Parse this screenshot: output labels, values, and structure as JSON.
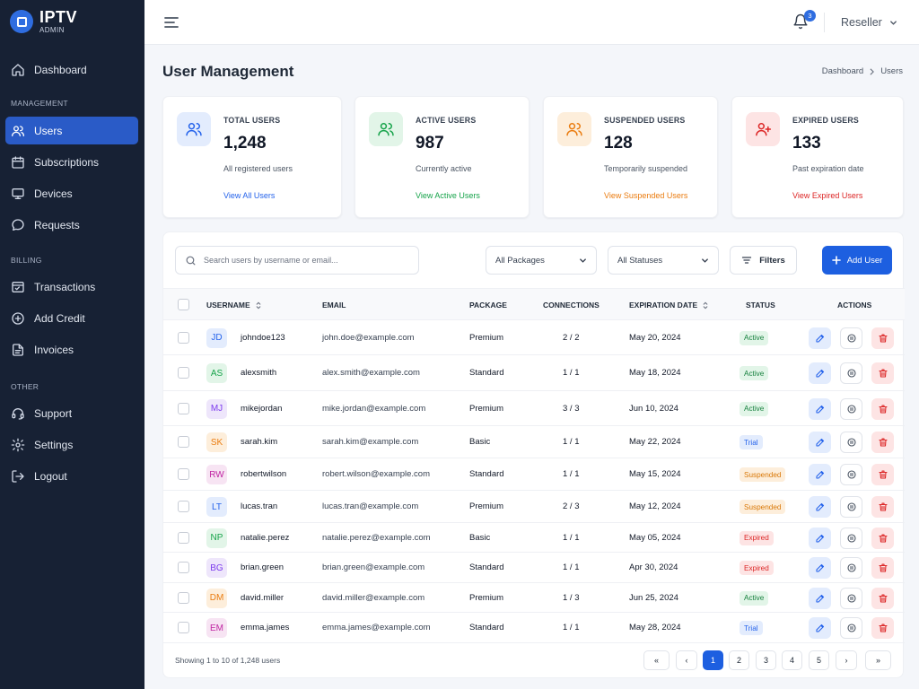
{
  "brand": {
    "title": "IPTV",
    "subtitle": "ADMIN"
  },
  "sidebar": {
    "sections": {
      "management": "MANAGEMENT",
      "billing": "BILLING",
      "other": "OTHER"
    },
    "items": [
      {
        "label": "Dashboard",
        "icon": "home-icon"
      },
      {
        "label": "Users",
        "icon": "users-icon",
        "active": true
      },
      {
        "label": "Subscriptions",
        "icon": "calendar-icon"
      },
      {
        "label": "Devices",
        "icon": "monitor-icon"
      },
      {
        "label": "Requests",
        "icon": "message-icon"
      },
      {
        "label": "Transactions",
        "icon": "receipt-icon"
      },
      {
        "label": "Add Credit",
        "icon": "plus-circle-icon"
      },
      {
        "label": "Invoices",
        "icon": "document-icon"
      },
      {
        "label": "Support",
        "icon": "headset-icon"
      },
      {
        "label": "Settings",
        "icon": "gear-icon"
      },
      {
        "label": "Logout",
        "icon": "logout-icon"
      }
    ]
  },
  "topbar": {
    "notifications": "3",
    "user": "Reseller"
  },
  "page": {
    "title": "User Management",
    "breadcrumb": [
      "Dashboard",
      "Users"
    ]
  },
  "stats": [
    {
      "label": "TOTAL USERS",
      "value": "1,248",
      "sub": "All registered users",
      "link": "View All Users",
      "color": "#2563eb",
      "bg": "#e3ecfd",
      "icon": "users-icon"
    },
    {
      "label": "ACTIVE USERS",
      "value": "987",
      "sub": "Currently active",
      "link": "View Active Users",
      "color": "#16a34a",
      "bg": "#e2f5e8",
      "icon": "users-icon"
    },
    {
      "label": "SUSPENDED USERS",
      "value": "128",
      "sub": "Temporarily suspended",
      "link": "View Suspended Users",
      "color": "#ea7c10",
      "bg": "#fdeedb",
      "icon": "users-icon"
    },
    {
      "label": "EXPIRED USERS",
      "value": "133",
      "sub": "Past expiration date",
      "link": "View Expired Users",
      "color": "#dc2626",
      "bg": "#fde4e4",
      "icon": "user-plus-icon"
    }
  ],
  "toolbar": {
    "search_placeholder": "Search users by username or email...",
    "package": "All Packages",
    "status": "All Statuses",
    "filters": "Filters",
    "add": "Add User"
  },
  "table": {
    "headers": {
      "username": "USERNAME",
      "email": "EMAIL",
      "package": "PACKAGE",
      "connections": "CONNECTIONS",
      "expiration": "EXPIRATION DATE",
      "status": "STATUS",
      "actions": "ACTIONS"
    },
    "rows": [
      {
        "initials": "JD",
        "username": "johndoe123",
        "email": "john.doe@example.com",
        "package": "Premium",
        "connections": "2 / 2",
        "expiration": "May 20, 2024",
        "status": "Active",
        "avatar_bg": "#e3ecfd",
        "avatar_fg": "#2563eb"
      },
      {
        "initials": "AS",
        "username": "alexsmith",
        "email": "alex.smith@example.com",
        "package": "Standard",
        "connections": "1 / 1",
        "expiration": "May 18, 2024",
        "status": "Active",
        "avatar_bg": "#e2f5e8",
        "avatar_fg": "#16a34a"
      },
      {
        "initials": "MJ",
        "username": "mikejordan",
        "email": "mike.jordan@example.com",
        "package": "Premium",
        "connections": "3 / 3",
        "expiration": "Jun 10, 2024",
        "status": "Active",
        "avatar_bg": "#eee6fb",
        "avatar_fg": "#7c3aed"
      },
      {
        "initials": "SK",
        "username": "sarah.kim",
        "email": "sarah.kim@example.com",
        "package": "Basic",
        "connections": "1 / 1",
        "expiration": "May 22, 2024",
        "status": "Trial",
        "avatar_bg": "#fdeedb",
        "avatar_fg": "#ea7c10"
      },
      {
        "initials": "RW",
        "username": "robertwilson",
        "email": "robert.wilson@example.com",
        "package": "Standard",
        "connections": "1 / 1",
        "expiration": "May 15, 2024",
        "status": "Suspended",
        "avatar_bg": "#f7e4f3",
        "avatar_fg": "#c026a3"
      },
      {
        "initials": "LT",
        "username": "lucas.tran",
        "email": "lucas.tran@example.com",
        "package": "Premium",
        "connections": "2 / 3",
        "expiration": "May 12, 2024",
        "status": "Suspended",
        "avatar_bg": "#e3ecfd",
        "avatar_fg": "#2563eb"
      },
      {
        "initials": "NP",
        "username": "natalie.perez",
        "email": "natalie.perez@example.com",
        "package": "Basic",
        "connections": "1 / 1",
        "expiration": "May 05, 2024",
        "status": "Expired",
        "avatar_bg": "#e2f5e8",
        "avatar_fg": "#16a34a"
      },
      {
        "initials": "BG",
        "username": "brian.green",
        "email": "brian.green@example.com",
        "package": "Standard",
        "connections": "1 / 1",
        "expiration": "Apr 30, 2024",
        "status": "Expired",
        "avatar_bg": "#eee6fb",
        "avatar_fg": "#7c3aed"
      },
      {
        "initials": "DM",
        "username": "david.miller",
        "email": "david.miller@example.com",
        "package": "Premium",
        "connections": "1 / 3",
        "expiration": "Jun 25, 2024",
        "status": "Active",
        "avatar_bg": "#fdeedb",
        "avatar_fg": "#ea7c10"
      },
      {
        "initials": "EM",
        "username": "emma.james",
        "email": "emma.james@example.com",
        "package": "Standard",
        "connections": "1 / 1",
        "expiration": "May 28, 2024",
        "status": "Trial",
        "avatar_bg": "#f7e4f3",
        "avatar_fg": "#c026a3"
      }
    ]
  },
  "status_colors": {
    "Active": {
      "bg": "#e2f5e8",
      "fg": "#15803d"
    },
    "Trial": {
      "bg": "#e3ecfd",
      "fg": "#2563eb"
    },
    "Suspended": {
      "bg": "#fdeedb",
      "fg": "#d97706"
    },
    "Expired": {
      "bg": "#fde4e4",
      "fg": "#dc2626"
    }
  },
  "actions": {
    "edit_icon": "pencil-icon",
    "pause_icon": "pause-icon",
    "delete_icon": "trash-icon"
  },
  "footer": {
    "showing": "Showing 1 to 10 of 1,248 users"
  },
  "pagination": {
    "first": "«",
    "prev": "‹",
    "pages": [
      "1",
      "2",
      "3",
      "4",
      "5"
    ],
    "current": "1",
    "next": "›",
    "last": "»"
  }
}
